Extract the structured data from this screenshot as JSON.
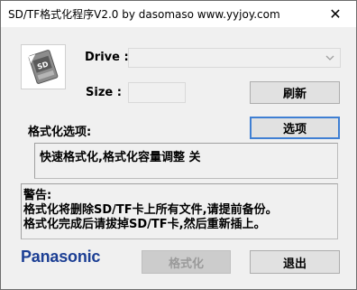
{
  "window": {
    "title": "SD/TF格式化程序V2.0 by dasomaso www.yyjoy.com",
    "close_symbol": "✕"
  },
  "drive": {
    "label": "Drive :",
    "value": ""
  },
  "size": {
    "label": "Size :",
    "value": ""
  },
  "buttons": {
    "refresh": "刷新",
    "options": "选项",
    "format": "格式化",
    "exit": "退出"
  },
  "options_section": {
    "label": "格式化选项:",
    "summary": "快速格式化,格式化容量调整 关"
  },
  "warning": {
    "title": "警告:",
    "line1": "格式化将删除SD/TF卡上所有文件,请提前备份。",
    "line2": "格式化完成后请拔掉SD/TF卡,然后重新插上。"
  },
  "brand": {
    "name": "Panasonic",
    "color": "#1c3f94"
  },
  "icons": {
    "app_logo": "sd-card-icon",
    "drive_dropdown": "chevron-down-icon",
    "close": "close-icon"
  }
}
